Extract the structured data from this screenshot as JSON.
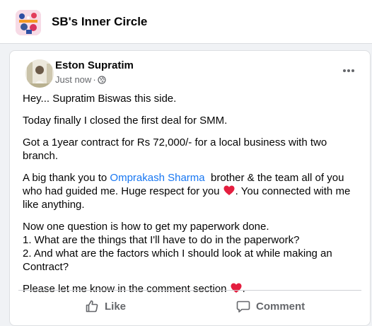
{
  "group": {
    "name": "SB's Inner Circle"
  },
  "post": {
    "author": "Eston Supratim",
    "timestamp": "Just now",
    "dot": "·",
    "privacy_icon": "globe-icon",
    "paragraphs": {
      "p1": "Hey... Supratim Biswas this side.",
      "p2": "Today finally I closed the first deal for SMM.",
      "p3": "Got a 1year contract for Rs 72,000/- for a local business with two branch.",
      "p4_before": "A big thank you to ",
      "p4_mention": "Omprakash Sharma",
      "p4_after": "  brother & the team all of you who had guided me. Huge respect for you ",
      "p4_end": ". You connected with me like anything.",
      "p5_line1": "Now one question is how to get my paperwork done.",
      "p5_line2": "1. What are the things that I'll have to do in the paperwork?",
      "p5_line3": "2. And what are the factors which I should look at while making an Contract?",
      "p6": "Please let me know in the comment section ",
      "p6_end": "."
    },
    "heart_color": "#e41e3f",
    "mention_color": "#1877f2"
  },
  "actions": {
    "like_label": "Like",
    "comment_label": "Comment"
  }
}
